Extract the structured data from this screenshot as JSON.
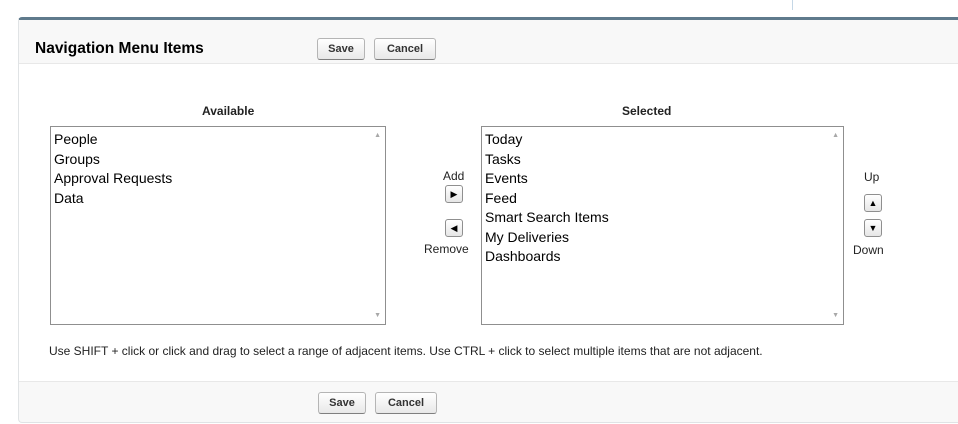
{
  "panel": {
    "title": "Navigation Menu Items",
    "save_label": "Save",
    "cancel_label": "Cancel"
  },
  "available": {
    "label": "Available",
    "items": [
      "People",
      "Groups",
      "Approval Requests",
      "Data"
    ]
  },
  "selected": {
    "label": "Selected",
    "items": [
      "Today",
      "Tasks",
      "Events",
      "Feed",
      "Smart Search Items",
      "My Deliveries",
      "Dashboards"
    ]
  },
  "movers": {
    "add_label": "Add",
    "remove_label": "Remove",
    "up_label": "Up",
    "down_label": "Down"
  },
  "help_text": "Use SHIFT + click or click and drag to select a range of adjacent items. Use CTRL + click to select multiple items that are not adjacent.",
  "colors": {
    "header_border": "#5f7a8c",
    "panel_background": "#f8f8f8"
  }
}
